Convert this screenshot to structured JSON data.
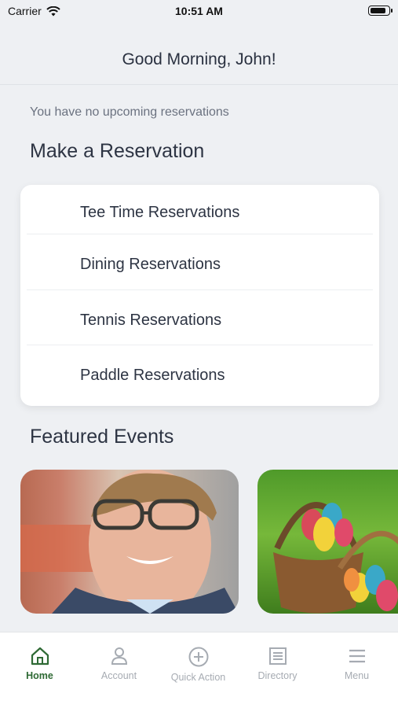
{
  "status": {
    "carrier": "Carrier",
    "time": "10:51 AM",
    "battery_level": 0.9
  },
  "header": {
    "greeting": "Good Morning, John!"
  },
  "main": {
    "no_reservations": "You have no upcoming reservations",
    "make_reservation_title": "Make a Reservation",
    "reservations": [
      "Tee Time Reservations",
      "Dining Reservations",
      "Tennis Reservations",
      "Paddle Reservations"
    ],
    "featured_title": "Featured Events"
  },
  "tabbar": {
    "items": [
      {
        "label": "Home",
        "icon": "home-icon",
        "active": true
      },
      {
        "label": "Account",
        "icon": "person-icon"
      },
      {
        "label": "Quick Action",
        "icon": "plus-circle-icon"
      },
      {
        "label": "Directory",
        "icon": "list-icon"
      },
      {
        "label": "Menu",
        "icon": "hamburger-icon"
      }
    ],
    "active_color": "#2f6a35",
    "inactive_color": "#a6abb2"
  }
}
